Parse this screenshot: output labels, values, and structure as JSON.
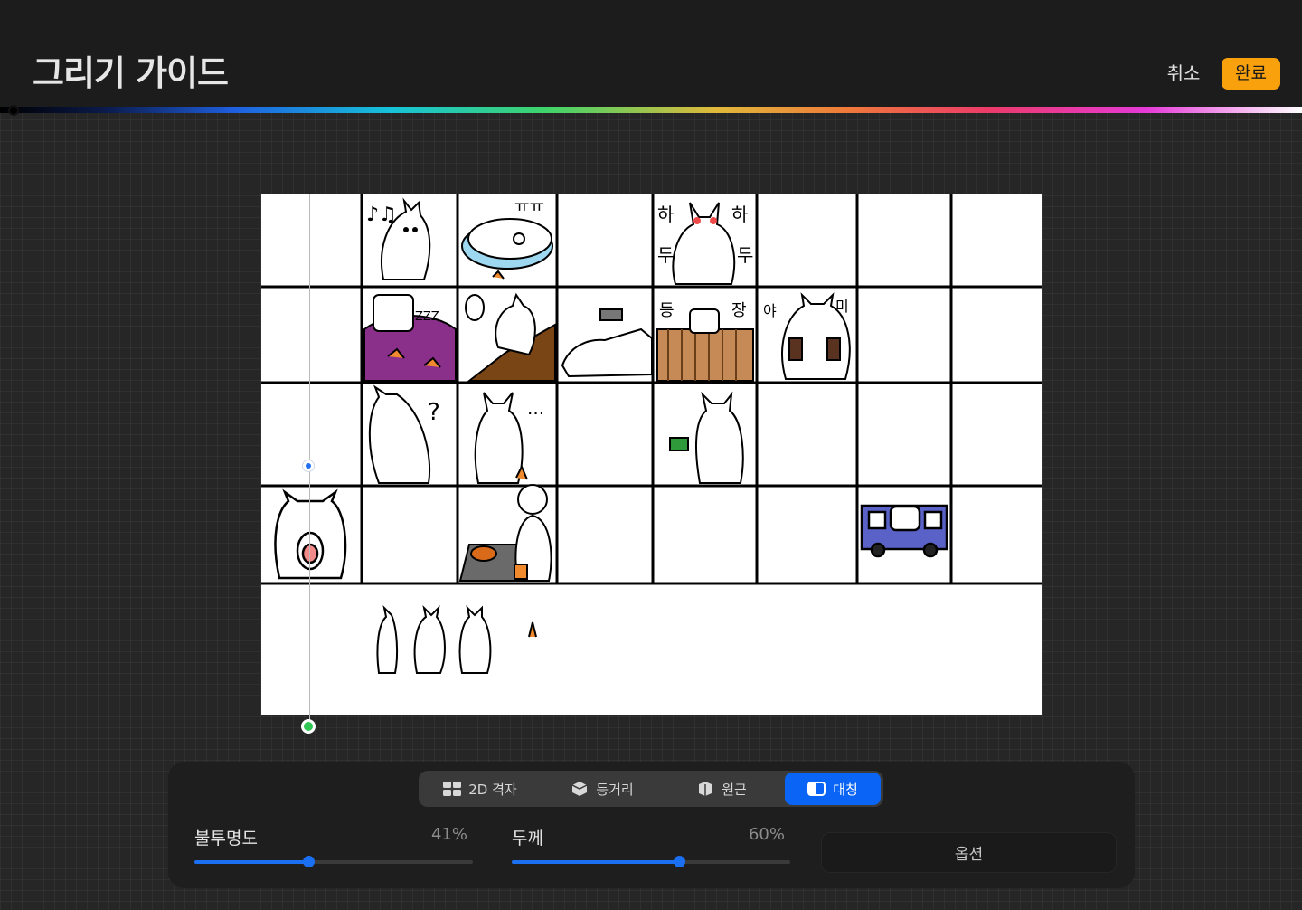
{
  "header": {
    "title": "그리기 가이드",
    "cancel_label": "취소",
    "done_label": "완료"
  },
  "canvas": {
    "sticker_texts": [
      "ㅠㅠ",
      "하",
      "하",
      "두",
      "두",
      "ZZZ",
      "등",
      "장",
      "야",
      "미",
      "?",
      "..."
    ]
  },
  "panel": {
    "tabs": [
      {
        "label": "2D 격자",
        "icon": "grid-2d-icon",
        "active": false
      },
      {
        "label": "등거리",
        "icon": "isometric-icon",
        "active": false
      },
      {
        "label": "원근",
        "icon": "perspective-icon",
        "active": false
      },
      {
        "label": "대칭",
        "icon": "symmetry-icon",
        "active": true
      }
    ],
    "opacity": {
      "label": "불투명도",
      "value_text": "41%",
      "value": 0.41
    },
    "thickness": {
      "label": "두께",
      "value_text": "60%",
      "value": 0.6
    },
    "options_label": "옵션"
  },
  "colors": {
    "accent": "#0a64f5",
    "done_button": "#f8a10d",
    "symmetry_handle_top": "#1f6ff0",
    "symmetry_handle_bottom": "#2fc654"
  }
}
